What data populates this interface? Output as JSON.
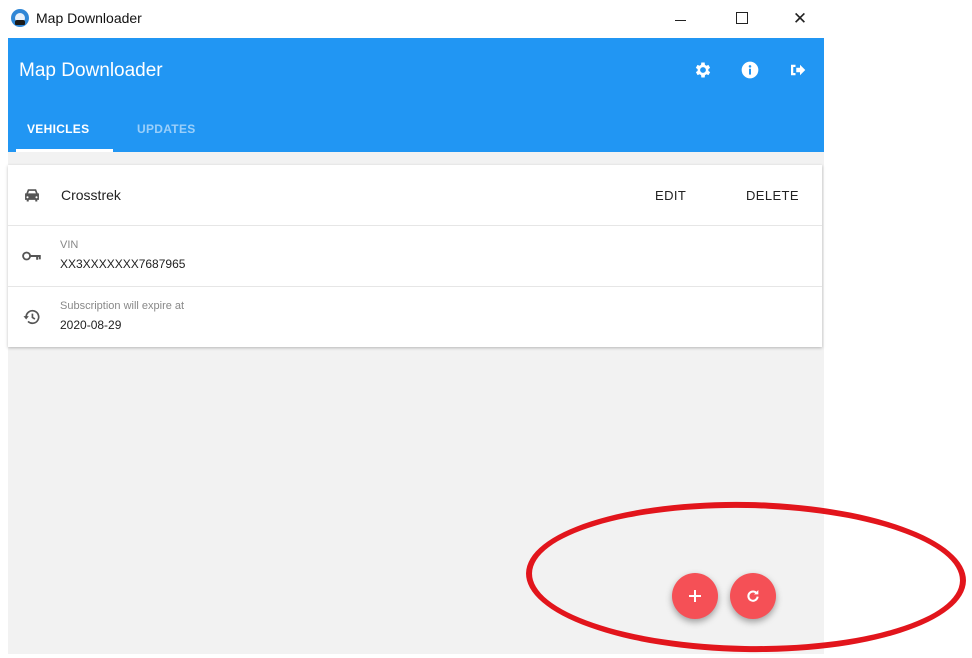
{
  "window": {
    "title": "Map Downloader",
    "icon": "app-globe-car-icon",
    "controls": {
      "minimize": "minimize-icon",
      "maximize": "maximize-icon",
      "close": "close-icon"
    }
  },
  "header": {
    "title": "Map Downloader",
    "background_color": "#2196f3",
    "icons": [
      "gear-icon",
      "info-icon",
      "logout-icon"
    ]
  },
  "tabs": [
    {
      "label": "VEHICLES",
      "active": true
    },
    {
      "label": "UPDATES",
      "active": false
    }
  ],
  "vehicle": {
    "name": "Crosstrek",
    "icon": "car-icon",
    "actions": {
      "edit": "EDIT",
      "delete": "DELETE"
    },
    "vin": {
      "label": "VIN",
      "value": "XX3XXXXXXX7687965",
      "icon": "key-icon"
    },
    "subscription": {
      "label": "Subscription will expire at",
      "value": "2020-08-29",
      "icon": "history-icon"
    }
  },
  "fabs": {
    "add": {
      "glyph": "+",
      "icon": "plus-icon"
    },
    "refresh": {
      "icon": "refresh-icon"
    },
    "color": "#f55056"
  },
  "annotation": {
    "shape": "ellipse",
    "color": "#e2151c"
  }
}
